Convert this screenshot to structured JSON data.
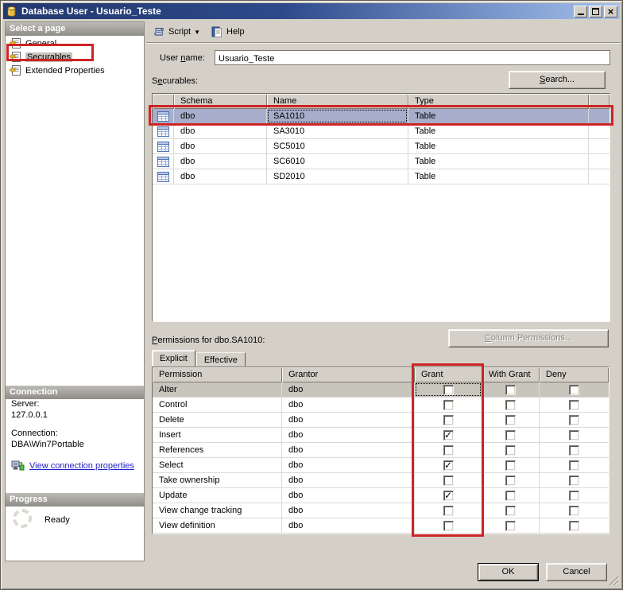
{
  "window": {
    "title": "Database User - Usuario_Teste"
  },
  "icons": {
    "app": "database-cylinder",
    "script": "scroll",
    "help": "document-book",
    "page": "property-page",
    "table_row": "table-grid",
    "connection": "computer-connect",
    "progress": "spinner-ring"
  },
  "sidebar": {
    "select_page_header": "Select a page",
    "pages": [
      {
        "label": "General",
        "selected": false
      },
      {
        "label": "Securables",
        "selected": true
      },
      {
        "label": "Extended Properties",
        "selected": false
      }
    ],
    "connection_header": "Connection",
    "server_label": "Server:",
    "server_value": "127.0.0.1",
    "connection_label": "Connection:",
    "connection_value": "DBA\\Win7Portable",
    "view_connection_link": "View connection properties",
    "progress_header": "Progress",
    "progress_status": "Ready"
  },
  "toolbar": {
    "script_label": "Script",
    "help_label": "Help"
  },
  "main": {
    "user_name_label": {
      "pre": "User ",
      "key": "n",
      "post": "ame:"
    },
    "user_name_value": "Usuario_Teste",
    "securables_label": {
      "pre": "S",
      "key": "e",
      "post": "curables:"
    },
    "search_button": {
      "key": "S",
      "post": "earch..."
    },
    "securables_table": {
      "columns": [
        "",
        "Schema",
        "Name",
        "Type",
        ""
      ],
      "rows": [
        {
          "schema": "dbo",
          "name": "SA1010",
          "type": "Table",
          "selected": true
        },
        {
          "schema": "dbo",
          "name": "SA3010",
          "type": "Table",
          "selected": false
        },
        {
          "schema": "dbo",
          "name": "SC5010",
          "type": "Table",
          "selected": false
        },
        {
          "schema": "dbo",
          "name": "SC6010",
          "type": "Table",
          "selected": false
        },
        {
          "schema": "dbo",
          "name": "SD2010",
          "type": "Table",
          "selected": false
        }
      ]
    },
    "permissions_label": {
      "key": "P",
      "post": "ermissions for dbo.SA1010:"
    },
    "column_permissions_button": {
      "key": "C",
      "post": "olumn Permissions..."
    },
    "tabs": [
      {
        "label": "Explicit",
        "active": true
      },
      {
        "label": "Effective",
        "active": false
      }
    ],
    "permissions_table": {
      "columns": [
        "Permission",
        "Grantor",
        "Grant",
        "With Grant",
        "Deny"
      ],
      "rows": [
        {
          "permission": "Alter",
          "grantor": "dbo",
          "grant": false,
          "with_grant": false,
          "deny": false,
          "selected": true
        },
        {
          "permission": "Control",
          "grantor": "dbo",
          "grant": false,
          "with_grant": false,
          "deny": false,
          "selected": false
        },
        {
          "permission": "Delete",
          "grantor": "dbo",
          "grant": false,
          "with_grant": false,
          "deny": false,
          "selected": false
        },
        {
          "permission": "Insert",
          "grantor": "dbo",
          "grant": true,
          "with_grant": false,
          "deny": false,
          "selected": false
        },
        {
          "permission": "References",
          "grantor": "dbo",
          "grant": false,
          "with_grant": false,
          "deny": false,
          "selected": false
        },
        {
          "permission": "Select",
          "grantor": "dbo",
          "grant": true,
          "with_grant": false,
          "deny": false,
          "selected": false
        },
        {
          "permission": "Take ownership",
          "grantor": "dbo",
          "grant": false,
          "with_grant": false,
          "deny": false,
          "selected": false
        },
        {
          "permission": "Update",
          "grantor": "dbo",
          "grant": true,
          "with_grant": false,
          "deny": false,
          "selected": false
        },
        {
          "permission": "View change tracking",
          "grantor": "dbo",
          "grant": false,
          "with_grant": false,
          "deny": false,
          "selected": false
        },
        {
          "permission": "View definition",
          "grantor": "dbo",
          "grant": false,
          "with_grant": false,
          "deny": false,
          "selected": false
        }
      ]
    }
  },
  "footer": {
    "ok_button": "OK",
    "cancel_button": "Cancel"
  },
  "colors": {
    "annotation_red": "#ce2424",
    "selection_blue": "#a7aecb",
    "selection_grey": "#c8c5bd",
    "link_blue": "#2222cc",
    "titlebar_left": "#24386e",
    "titlebar_right": "#a6c0e8"
  }
}
